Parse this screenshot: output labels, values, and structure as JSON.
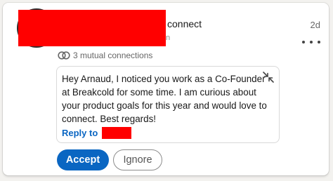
{
  "invitation": {
    "action_text": "connect",
    "headline_tail": "n",
    "time": "2d",
    "mutual_connections": "3 mutual connections",
    "message": "Hey Arnaud, I noticed you work as a Co-Founder at Breakcold for some time. I am curious about your product goals for this year and would love to connect. Best regards!",
    "reply_label": "Reply to",
    "accept_label": "Accept",
    "ignore_label": "Ignore"
  },
  "colors": {
    "accent": "#0a66c2",
    "redaction": "#ff0000"
  },
  "icons": {
    "mutual": "mutual-connections-icon",
    "more": "more-options-icon",
    "expand": "collapse-expand-icon"
  }
}
